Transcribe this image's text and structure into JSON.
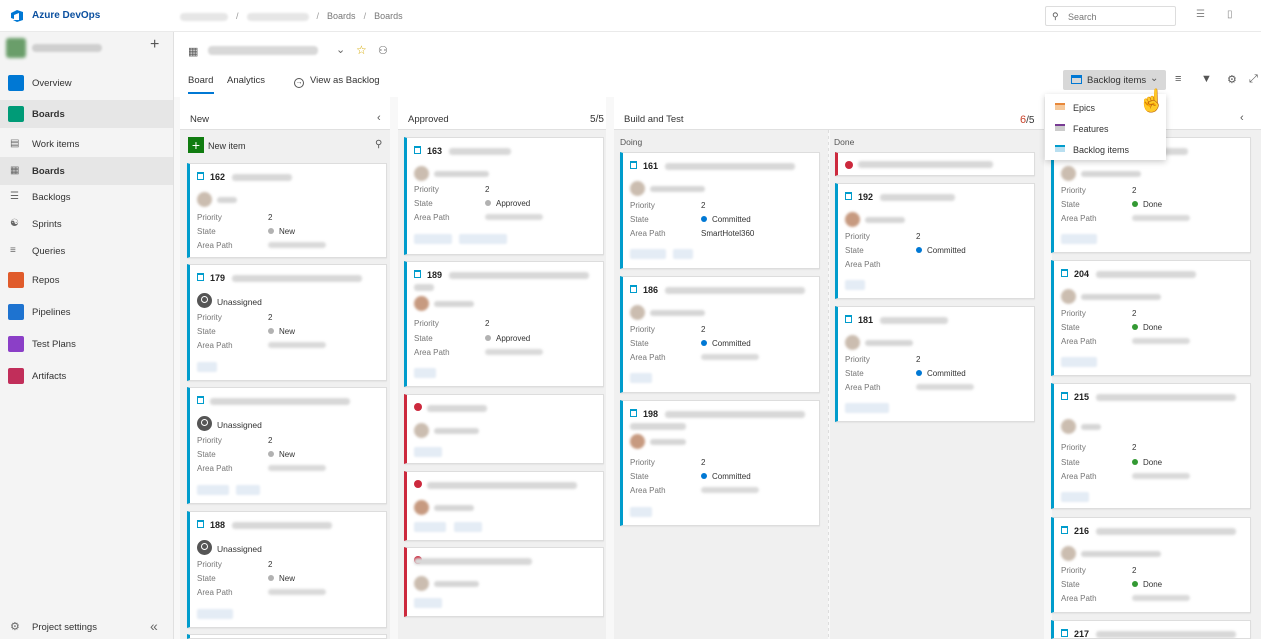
{
  "topbar": {
    "brand": "Azure DevOps",
    "breadcrumb": [
      "Boards",
      "Boards"
    ],
    "search_placeholder": "Search"
  },
  "sidebar": {
    "items": [
      {
        "label": "Overview",
        "icon": "overview-icon",
        "color": "#0078d4"
      },
      {
        "label": "Boards",
        "icon": "boards-icon",
        "color": "#009b77"
      },
      {
        "label": "Work items",
        "icon": "work-items-icon"
      },
      {
        "label": "Boards",
        "icon": "board-grid-icon"
      },
      {
        "label": "Backlogs",
        "icon": "backlogs-icon"
      },
      {
        "label": "Sprints",
        "icon": "sprints-icon"
      },
      {
        "label": "Queries",
        "icon": "queries-icon"
      },
      {
        "label": "Repos",
        "icon": "repos-icon",
        "color": "#e05b2b"
      },
      {
        "label": "Pipelines",
        "icon": "pipelines-icon",
        "color": "#1e73d0"
      },
      {
        "label": "Test Plans",
        "icon": "test-plans-icon",
        "color": "#8b3fc7"
      },
      {
        "label": "Artifacts",
        "icon": "artifacts-icon",
        "color": "#c12e5a"
      }
    ],
    "footer": "Project settings"
  },
  "header": {
    "tabs": [
      "Board",
      "Analytics"
    ],
    "view_as_backlog": "View as Backlog",
    "pivot_label": "Backlog items"
  },
  "menu": {
    "items": [
      {
        "label": "Epics",
        "color": "#e8883a"
      },
      {
        "label": "Features",
        "color": "#773b93"
      },
      {
        "label": "Backlog items",
        "color": "#009ccc"
      }
    ]
  },
  "columns": {
    "new": {
      "title": "New",
      "new_item": "New item"
    },
    "approved": {
      "title": "Approved",
      "limit": "5",
      "limit_max": "/5"
    },
    "build": {
      "title": "Build and Test",
      "limit": "6",
      "limit_max": "/5",
      "doing": "Doing",
      "done": "Done"
    }
  },
  "labels": {
    "priority": "Priority",
    "state": "State",
    "area": "Area Path",
    "unassigned": "Unassigned"
  },
  "cards": {
    "c162": {
      "id": "162",
      "priority": "2",
      "state": "New"
    },
    "c179": {
      "id": "179",
      "priority": "2",
      "state": "New"
    },
    "cx1": {
      "priority": "2",
      "state": "New"
    },
    "c188": {
      "id": "188",
      "priority": "2",
      "state": "New"
    },
    "c163": {
      "id": "163",
      "priority": "2",
      "state": "Approved"
    },
    "c189": {
      "id": "189",
      "priority": "2",
      "state": "Approved"
    },
    "c161": {
      "id": "161",
      "priority": "2",
      "state": "Committed",
      "area": "SmartHotel360"
    },
    "c186": {
      "id": "186",
      "priority": "2",
      "state": "Committed"
    },
    "c198": {
      "id": "198",
      "priority": "2",
      "state": "Committed"
    },
    "c192": {
      "id": "192",
      "priority": "2",
      "state": "Committed"
    },
    "c181": {
      "id": "181",
      "priority": "2",
      "state": "Committed"
    },
    "cdone1": {
      "priority": "2",
      "state": "Done"
    },
    "c204": {
      "id": "204",
      "priority": "2",
      "state": "Done"
    },
    "c215": {
      "id": "215",
      "priority": "2",
      "state": "Done"
    },
    "c216": {
      "id": "216",
      "priority": "2",
      "state": "Done"
    },
    "c217": {
      "id": "217"
    }
  },
  "colors": {
    "new": "#b2b2b2",
    "approved": "#b2b2b2",
    "committed": "#0078d4",
    "done": "#339933"
  }
}
